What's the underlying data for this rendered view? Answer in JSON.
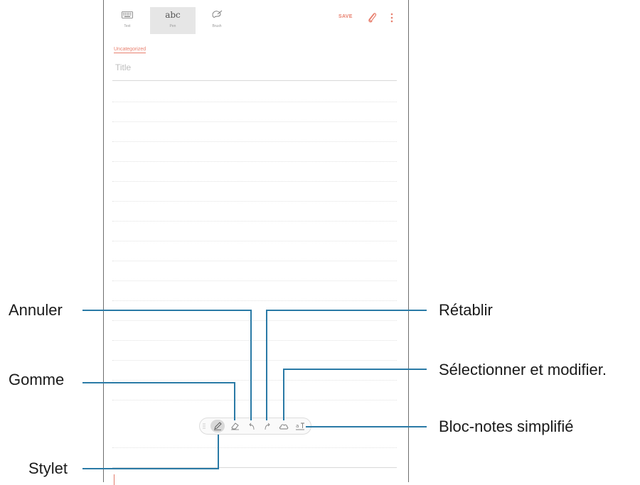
{
  "modes": [
    {
      "label": "Text"
    },
    {
      "label": "abc",
      "sublabel": "Pen"
    },
    {
      "label": "Brush"
    }
  ],
  "header": {
    "save_label": "SAVE"
  },
  "note": {
    "category": "Uncategorized",
    "title_placeholder": "Title"
  },
  "callouts": {
    "undo": "Annuler",
    "eraser": "Gomme",
    "pen": "Stylet",
    "redo": "Rétablir",
    "select": "Sélectionner et modifier.",
    "easy_writing": "Bloc-notes simplifié"
  },
  "colors": {
    "accent": "#e8806f",
    "callout_line": "#2a7aa6"
  },
  "icons": [
    "keyboard-icon",
    "brush-icon",
    "paperclip-icon",
    "more-vertical-icon",
    "drag-handle-icon",
    "pen-icon",
    "eraser-icon",
    "undo-icon",
    "redo-icon",
    "selection-icon",
    "easy-writing-pad-icon"
  ]
}
